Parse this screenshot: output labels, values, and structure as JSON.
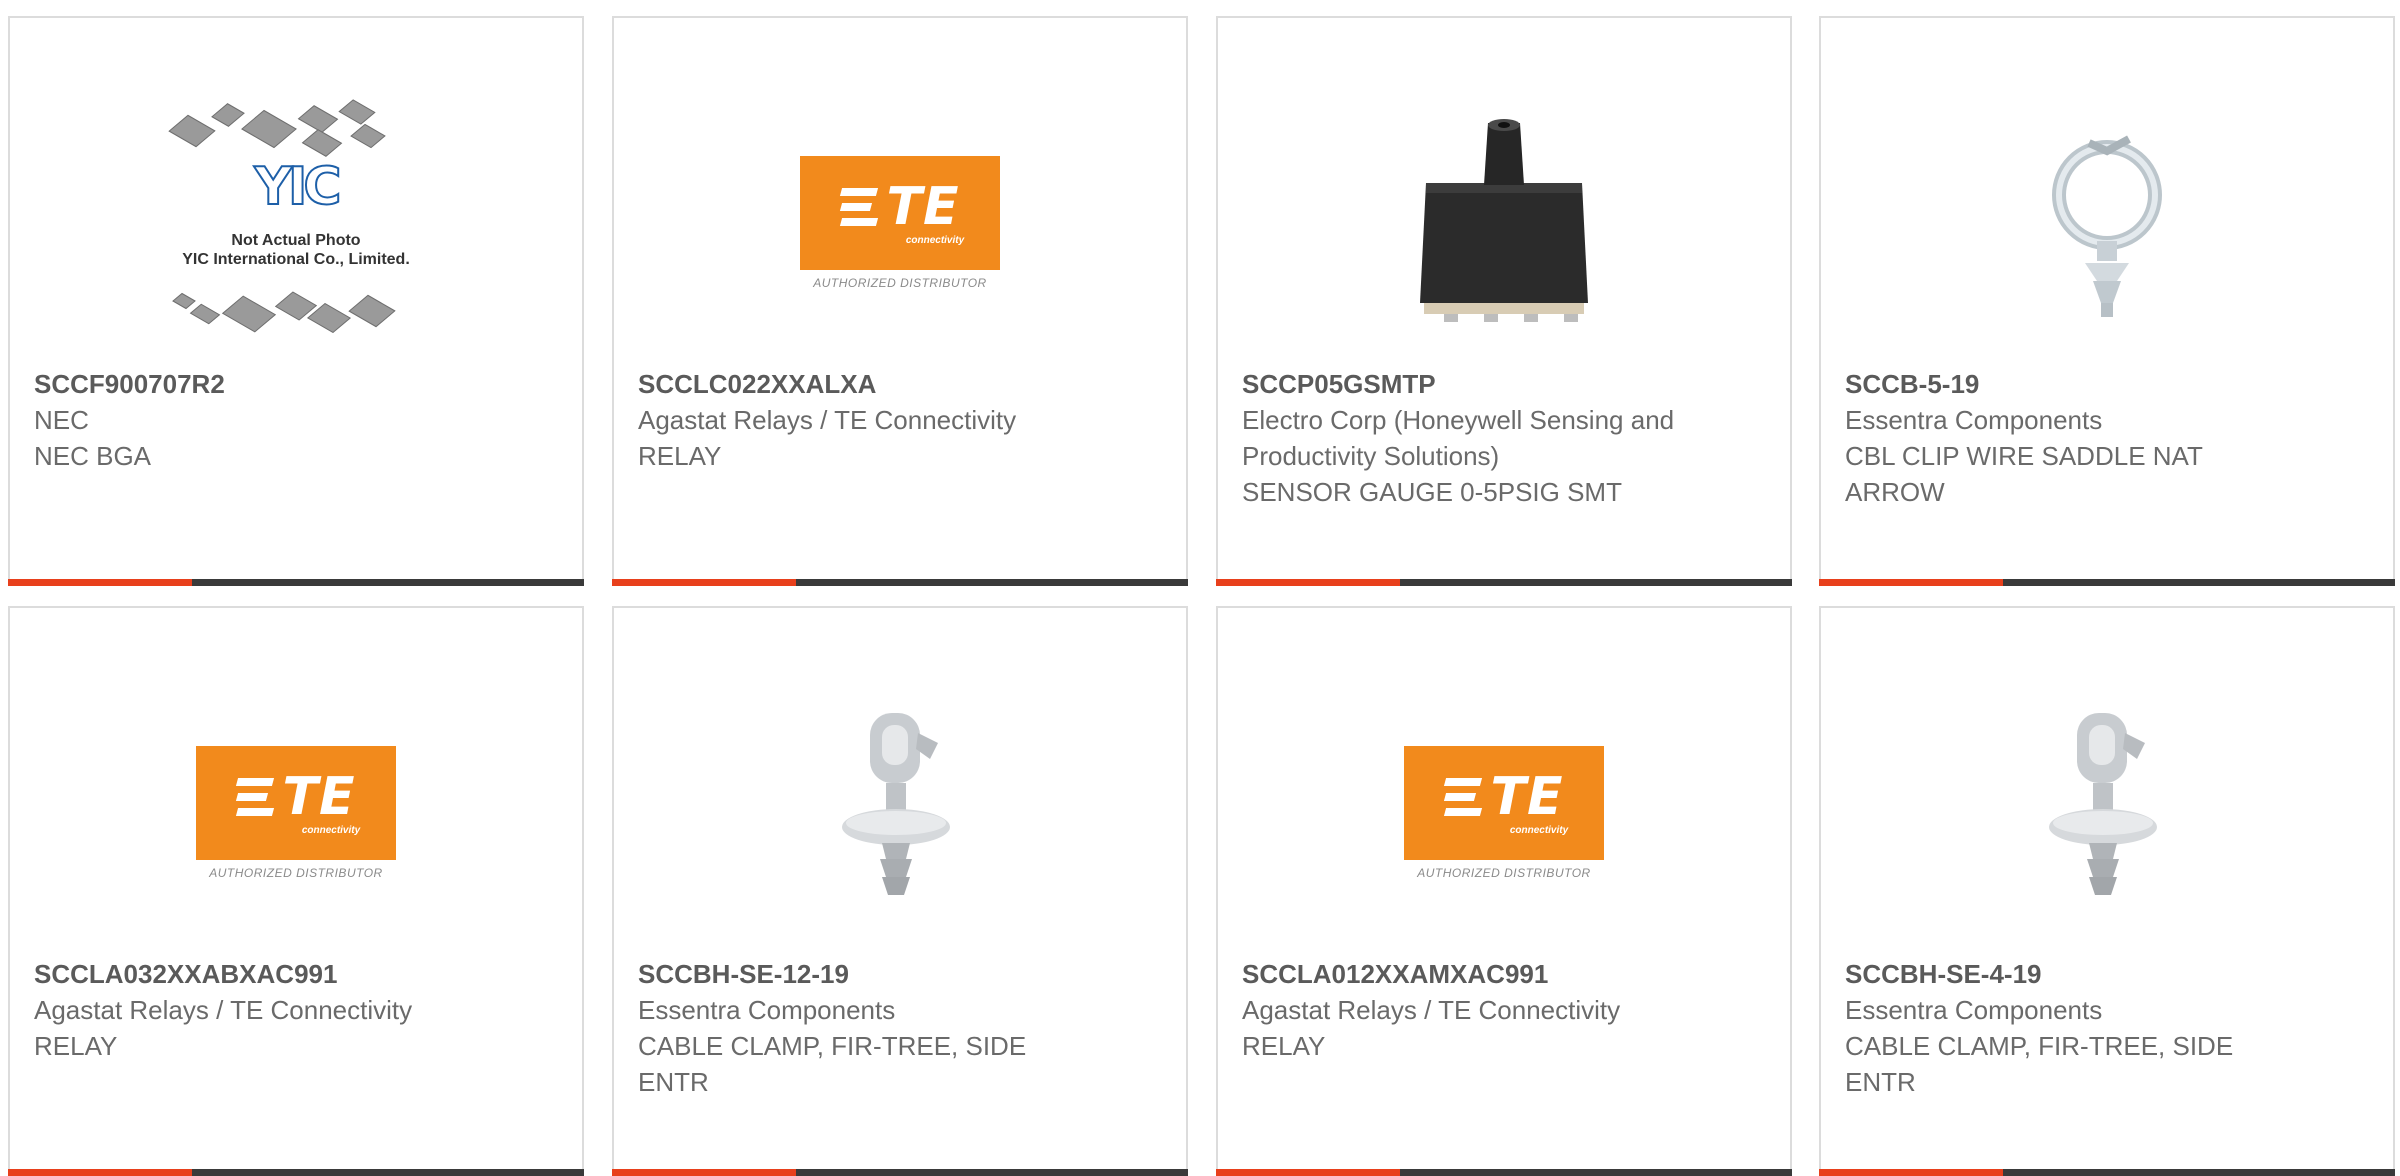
{
  "products": [
    {
      "part_number": "SCCF900707R2",
      "manufacturer": "NEC",
      "description": "NEC BGA",
      "image": "yic-placeholder",
      "placeholder_lines": [
        "Not Actual Photo",
        "YIC International Co., Limited."
      ]
    },
    {
      "part_number": "SCCLC022XXALXA",
      "manufacturer": "Agastat Relays / TE Connectivity",
      "description": "RELAY",
      "image": "te-logo"
    },
    {
      "part_number": "SCCP05GSMTP",
      "manufacturer": "Electro Corp (Honeywell Sensing and Productivity Solutions)",
      "description": "SENSOR GAUGE 0-5PSIG SMT",
      "image": "pressure-sensor"
    },
    {
      "part_number": "SCCB-5-19",
      "manufacturer": "Essentra Components",
      "description": "CBL CLIP WIRE SADDLE NAT ARROW",
      "image": "cable-clip"
    },
    {
      "part_number": "SCCLA032XXABXAC991",
      "manufacturer": "Agastat Relays / TE Connectivity",
      "description": "RELAY",
      "image": "te-logo"
    },
    {
      "part_number": "SCCBH-SE-12-19",
      "manufacturer": "Essentra Components",
      "description": "CABLE CLAMP, FIR-TREE, SIDE ENTR",
      "image": "cable-clamp"
    },
    {
      "part_number": "SCCLA012XXAMXAC991",
      "manufacturer": "Agastat Relays / TE Connectivity",
      "description": "RELAY",
      "image": "te-logo"
    },
    {
      "part_number": "SCCBH-SE-4-19",
      "manufacturer": "Essentra Components",
      "description": "CABLE CLAMP, FIR-TREE, SIDE ENTR",
      "image": "cable-clamp"
    }
  ],
  "te_logo": {
    "word": "TE",
    "sub": "connectivity",
    "authorized": "AUTHORIZED DISTRIBUTOR"
  },
  "yic_logo_text": "YIC",
  "colors": {
    "accent_red": "#e8401c",
    "accent_dark": "#3a3a3a",
    "te_orange": "#f28a1c",
    "border": "#dcdcdc"
  }
}
